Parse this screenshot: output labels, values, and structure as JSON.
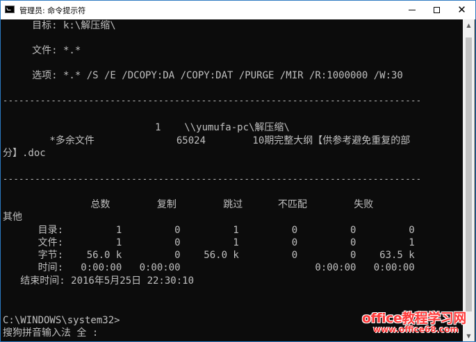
{
  "window": {
    "title": "管理员: 命令提示符"
  },
  "console": {
    "lines": {
      "l01": "     目标: k:\\解压缩\\",
      "l02": "     文件: *.*",
      "l03": "     选项: *.* /S /E /DCOPY:DA /COPY:DAT /PURGE /MIR /R:1000000 /W:30",
      "l04": "------------------------------------------------------------------------------",
      "l05": "                          1    \\\\yumufa-pc\\解压缩\\",
      "l06": "        *多余文件              65024        10期完整大纲【供参考避免重复的部",
      "l07": "分】.doc",
      "l08": "------------------------------------------------------------------------------",
      "l09": "               总数        复制        跳过      不匹配        失败",
      "l10": "其他",
      "l11": "      目录:         1         0         1         0         0         0",
      "l12": "      文件:         1         0         1         0         0         1",
      "l13": "      字节:    56.0 k         0    56.0 k         0         0    63.5 k",
      "l14": "      时间:   0:00:00   0:00:00                       0:00:00   0:00:00",
      "l15": "   结束时间: 2016年5月25日 22:30:10",
      "l16": "C:\\WINDOWS\\system32>",
      "l17": "搜狗拼音输入法 全 :"
    }
  },
  "watermark": {
    "main": "office教程学习网",
    "url": "www.office68.com"
  },
  "colors": {
    "console_bg": "#0c0c0c",
    "console_fg": "#c0c0c0",
    "watermark": "#ff3a3a"
  },
  "icons": {
    "app": "console-icon",
    "minimize": "minimize-icon",
    "maximize": "maximize-icon",
    "close": "close-icon"
  }
}
